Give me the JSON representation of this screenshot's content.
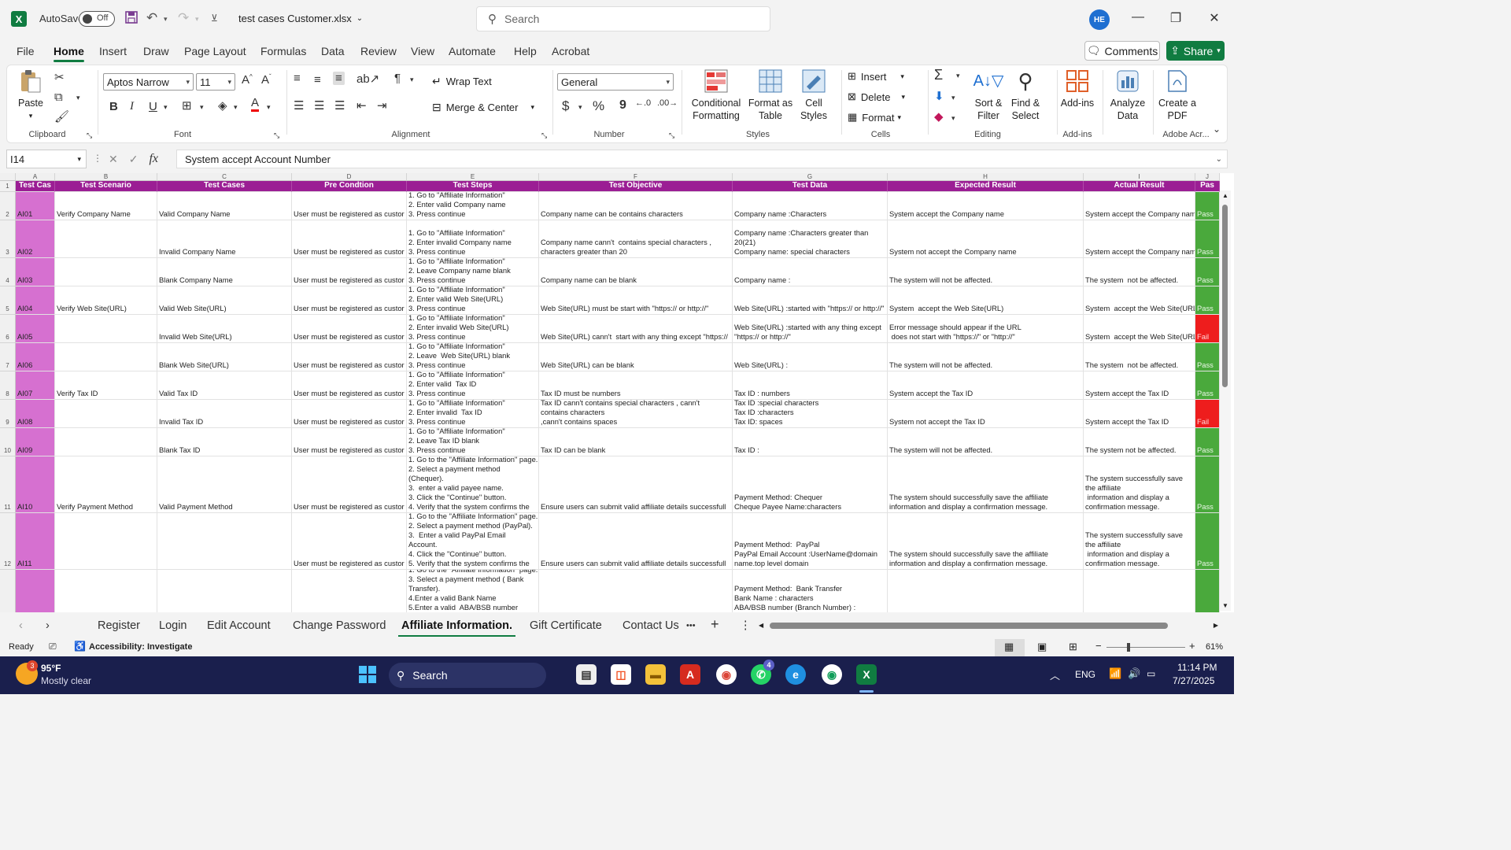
{
  "titlebar": {
    "app_icon": "X",
    "autosave_label": "AutoSave",
    "autosave_state": "Off",
    "filename": "test cases Customer.xlsx",
    "search_placeholder": "Search",
    "user_initials": "HE"
  },
  "menu": {
    "tabs": [
      "File",
      "Home",
      "Insert",
      "Draw",
      "Page Layout",
      "Formulas",
      "Data",
      "Review",
      "View",
      "Automate",
      "Help",
      "Acrobat"
    ],
    "active": "Home",
    "comments_label": "Comments",
    "share_label": "Share"
  },
  "ribbon": {
    "clipboard": {
      "paste": "Paste",
      "label": "Clipboard"
    },
    "font": {
      "name": "Aptos Narrow",
      "size": "11",
      "label": "Font",
      "bold": "B",
      "italic": "I",
      "underline": "U"
    },
    "alignment": {
      "wrap_text": "Wrap Text",
      "merge_center": "Merge & Center",
      "label": "Alignment"
    },
    "number": {
      "format": "General",
      "currency": "$",
      "percent": "%",
      "comma": "9",
      "label": "Number"
    },
    "styles": {
      "conditional": "Conditional Formatting",
      "format_table": "Format as Table",
      "cell_styles": "Cell Styles",
      "label": "Styles"
    },
    "cells": {
      "insert": "Insert",
      "delete": "Delete",
      "format": "Format",
      "label": "Cells"
    },
    "editing": {
      "sort_filter": "Sort & Filter",
      "find_select": "Find & Select",
      "label": "Editing"
    },
    "addins": {
      "addins": "Add-ins",
      "label": "Add-ins"
    },
    "analyze": {
      "label": "Analyze Data"
    },
    "acrobat": {
      "create_pdf": "Create a PDF",
      "label": "Adobe Acr..."
    }
  },
  "formula_bar": {
    "cell_ref": "I14",
    "fx": "fx",
    "content": "System  accept Account Number"
  },
  "sheet": {
    "columns": [
      "A",
      "B",
      "C",
      "D",
      "E",
      "F",
      "G",
      "H",
      "I",
      "J"
    ],
    "headers": [
      "Test Cas",
      "Test Scenario",
      "Test Cases",
      "Pre Condtion",
      "Test Steps",
      "Test Objective",
      "Test Data",
      "Expected Result",
      "Actual Result",
      "Pas"
    ],
    "rows": [
      {
        "num": "2",
        "id": "AI01",
        "scenario": "Verify Company Name",
        "case": "Valid Company Name",
        "pre": "User must be registered as custor",
        "steps": "1. Go to \"Affiliate Information\"\n2. Enter valid Company name\n3. Press continue",
        "objective": "Company name can be contains characters",
        "tdata": "Company name :Characters",
        "expected": "System accept the Company name",
        "actual": "System accept the Company nam",
        "status": "Pass"
      },
      {
        "num": "3",
        "id": "AI02",
        "scenario": "",
        "case": "Invalid Company Name",
        "pre": "User must be registered as custor",
        "steps": "1. Go to \"Affiliate Information\"\n2. Enter invalid Company name\n3. Press continue",
        "objective": "Company name cann't  contains special characters ,\ncharacters greater than 20",
        "tdata": "Company name :Characters greater than\n20(21)\nCompany name: special characters",
        "expected": "System not accept the Company name",
        "actual": "System accept the Company nam",
        "status": "Pass"
      },
      {
        "num": "4",
        "id": "AI03",
        "scenario": "",
        "case": "Blank Company Name",
        "pre": "User must be registered as custor",
        "steps": "1. Go to \"Affiliate Information\"\n2. Leave Company name blank\n3. Press continue",
        "objective": "Company name can be blank",
        "tdata": "Company name :",
        "expected": "The system will not be affected.",
        "actual": "The system  not be affected.",
        "status": "Pass"
      },
      {
        "num": "5",
        "id": "AI04",
        "scenario": "Verify Web Site(URL)",
        "case": "Valid Web Site(URL)",
        "pre": "User must be registered as custor",
        "steps": "1. Go to \"Affiliate Information\"\n2. Enter valid Web Site(URL)\n3. Press continue",
        "objective": "Web Site(URL) must be start with \"https:// or http://\"",
        "tdata": "Web Site(URL) :started with \"https:// or http://\"",
        "expected": "System  accept the Web Site(URL)",
        "actual": "System  accept the Web Site(URL",
        "status": "Pass"
      },
      {
        "num": "6",
        "id": "AI05",
        "scenario": "",
        "case": "Invalid Web Site(URL)",
        "pre": "User must be registered as custor",
        "steps": "1. Go to \"Affiliate Information\"\n2. Enter invalid Web Site(URL)\n3. Press continue",
        "objective": "Web Site(URL) cann't  start with any thing except \"https://",
        "tdata": "Web Site(URL) :started with any thing except\n\"https:// or http://\"",
        "expected": "Error message should appear if the URL\n does not start with \"https://\" or \"http://\"",
        "actual": "System  accept the Web Site(URL",
        "status": "Fail"
      },
      {
        "num": "7",
        "id": "AI06",
        "scenario": "",
        "case": "Blank Web Site(URL)",
        "pre": "User must be registered as custor",
        "steps": "1. Go to \"Affiliate Information\"\n2. Leave  Web Site(URL) blank\n3. Press continue",
        "objective": "Web Site(URL) can be blank",
        "tdata": "Web Site(URL) :",
        "expected": "The system will not be affected.",
        "actual": "The system  not be affected.",
        "status": "Pass"
      },
      {
        "num": "8",
        "id": "AI07",
        "scenario": "Verify Tax ID",
        "case": "Valid Tax ID",
        "pre": "User must be registered as custor",
        "steps": "1. Go to \"Affiliate Information\"\n2. Enter valid  Tax ID\n3. Press continue",
        "objective": "Tax ID must be numbers",
        "tdata": "Tax ID : numbers",
        "expected": "System accept the Tax ID",
        "actual": "System accept the Tax ID",
        "status": "Pass"
      },
      {
        "num": "9",
        "id": "AI08",
        "scenario": "",
        "case": "Invalid Tax ID",
        "pre": "User must be registered as custor",
        "steps": "1. Go to \"Affiliate Information\"\n2. Enter invalid  Tax ID\n3. Press continue",
        "objective": "Tax ID cann't contains special characters , cann't\ncontains characters\n,cann't contains spaces",
        "tdata": "Tax ID :special characters\nTax ID :characters\nTax ID: spaces",
        "expected": "System not accept the Tax ID",
        "actual": "System accept the Tax ID",
        "status": "Fail"
      },
      {
        "num": "10",
        "id": "AI09",
        "scenario": "",
        "case": "Blank Tax ID",
        "pre": "User must be registered as custor",
        "steps": "1. Go to \"Affiliate Information\"\n2. Leave Tax ID blank\n3. Press continue",
        "objective": "Tax ID can be blank",
        "tdata": "Tax ID :",
        "expected": "The system will not be affected.",
        "actual": "The system not be affected.",
        "status": "Pass"
      },
      {
        "num": "11",
        "id": "AI10",
        "scenario": "Verify Payment Method",
        "case": "Valid Payment Method",
        "pre": "User must be registered as custor",
        "steps": "1. Go to the \"Affiliate Information\" page.\n2. Select a payment method\n(Chequer).\n3.  enter a valid payee name.\n3. Click the \"Continue\" button.\n4. Verify that the system confirms the",
        "objective": "Ensure users can submit valid affiliate details successfull",
        "tdata": "Payment Method: Chequer\nCheque Payee Name:characters",
        "expected": "The system should successfully save the affiliate\ninformation and display a confirmation message.",
        "actual": "The system successfully save\nthe affiliate\n information and display a\nconfirmation message.",
        "status": "Pass"
      },
      {
        "num": "12",
        "id": "AI11",
        "scenario": "",
        "case": "",
        "pre": "User must be registered as custor",
        "steps": "1. Go to the \"Affiliate Information\" page.\n2. Select a payment method (PayPal).\n3.  Enter a valid PayPal Email\nAccount.\n4. Click the \"Continue\" button.\n5. Verify that the system confirms the",
        "objective": "Ensure users can submit valid affiliate details successfull",
        "tdata": "Payment Method:  PayPal\nPayPal Email Account :UserName@domain\nname.top level domain",
        "expected": "The system should successfully save the affiliate\ninformation and display a confirmation message.",
        "actual": "The system successfully save\nthe affiliate\n information and display a\nconfirmation message.",
        "status": "Pass"
      },
      {
        "num": "",
        "id": "",
        "scenario": "",
        "case": "",
        "pre": "",
        "steps": "1. Go to the \"Affiliate Information\" page.\n3. Select a payment method ( Bank\nTransfer).\n4.Enter a valid Bank Name\n5.Enter a valid  ABA/BSB number",
        "objective": "",
        "tdata": "Payment Method:  Bank Transfer\nBank Name : characters\nABA/BSB number (Branch Number) :",
        "expected": "",
        "actual": "",
        "status": ""
      }
    ]
  },
  "sheet_tabs": {
    "tabs": [
      "Register",
      "Login",
      "Edit Account",
      "Change Password",
      "Affiliate Information.",
      "Gift Certificate",
      "Contact Us"
    ],
    "active": "Affiliate Information.",
    "more": "•••",
    "add": "+"
  },
  "statusbar": {
    "ready": "Ready",
    "accessibility": "Accessibility: Investigate",
    "zoom": "61%"
  },
  "taskbar": {
    "weather_temp": "95°F",
    "weather_desc": "Mostly clear",
    "search": "Search",
    "lang": "ENG",
    "time": "11:14 PM",
    "date": "7/27/2025",
    "whatsapp_badge": "4",
    "weather_badge": "3"
  }
}
